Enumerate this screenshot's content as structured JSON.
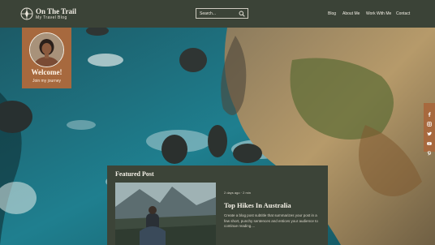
{
  "header": {
    "title": "On The Trail",
    "subtitle": "My Travel Blog",
    "search": {
      "placeholder": "Search..."
    },
    "nav": [
      {
        "label": "Blog"
      },
      {
        "label": "About Me"
      },
      {
        "label": "Work With Me"
      },
      {
        "label": "Contact"
      }
    ]
  },
  "welcome": {
    "title": "Welcome!",
    "subtitle": "Join my journey"
  },
  "social": [
    "facebook-icon",
    "instagram-icon",
    "twitter-icon",
    "youtube-icon",
    "pinterest-icon"
  ],
  "featured": {
    "heading": "Featured Post",
    "date": "2 days ago",
    "read_time": "2 min",
    "title": "Top Hikes In Australia",
    "excerpt": "Create a blog post subtitle that summarizes your post in a few short, punchy sentences and entices your audience to continue reading...."
  },
  "colors": {
    "header_bg": "#3b4337",
    "accent": "#a7693e",
    "panel_bg": "#3c4438"
  }
}
